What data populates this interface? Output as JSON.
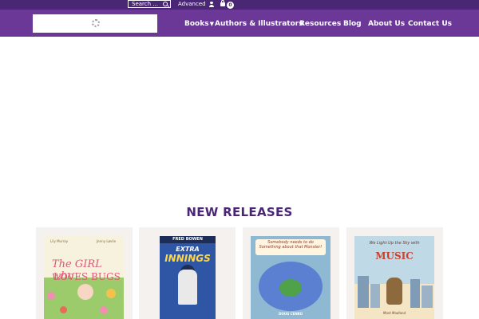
{
  "topbar": {
    "search_placeholder": "Search ...",
    "advanced_label": "Advanced",
    "cart_count": "0"
  },
  "nav": {
    "items": [
      "Books",
      "Authors & Illustrators",
      "Resources",
      "Blog",
      "About Us",
      "Contact Us"
    ]
  },
  "main": {
    "heading": "NEW RELEASES"
  },
  "books": [
    {
      "title_line1": "The GIRL who",
      "title_line2": "LOVES BUGS",
      "author": "Lily Murray",
      "illustrator": "Jenny Løvlie"
    },
    {
      "series_author": "FRED BOWEN",
      "title_line1": "EXTRA",
      "title_line2": "INNINGS"
    },
    {
      "title": "Somebody needs to do Something about that Monster!",
      "author": "DOUG CENKO"
    },
    {
      "title_line1": "We Light Up the Sky with",
      "title_line2": "MUSIC",
      "author": "Mark Madland"
    }
  ],
  "colors": {
    "topbar": "#4a2775",
    "navbar": "#6b3897",
    "heading": "#4a2775",
    "card_bg": "#f5f1ee"
  },
  "icons": [
    "search-icon",
    "user-icon",
    "cart-icon",
    "loading-spinner-icon",
    "chevron-down-icon"
  ]
}
